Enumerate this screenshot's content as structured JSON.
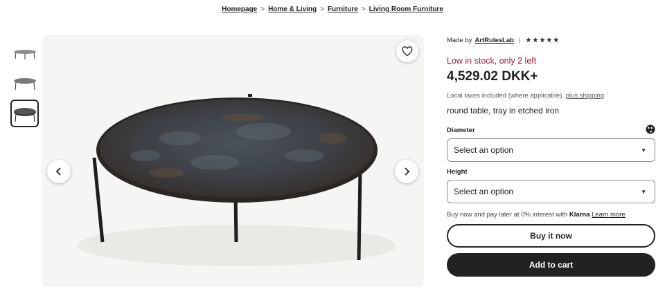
{
  "breadcrumb": {
    "items": [
      "Homepage",
      "Home & Living",
      "Furniture",
      "Living Room Furniture"
    ],
    "separator": ">"
  },
  "gallery": {
    "thumbnails": [
      "table-thumbnail-1",
      "table-thumbnail-2",
      "table-thumbnail-3"
    ],
    "active_index": 2,
    "prev_icon": "chevron-left-icon",
    "next_icon": "chevron-right-icon",
    "favorite_icon": "heart-icon"
  },
  "product": {
    "made_by_label": "Made by",
    "seller": "ArtRulesLab",
    "separator": "|",
    "rating_stars": "★★★★★",
    "rating": 5,
    "stock_notice": "Low in stock, only 2 left",
    "price": "4,529.02 DKK+",
    "tax_note": "Local taxes included (where applicable),",
    "shipping_link": "plus shipping",
    "title": "round table, tray in etched iron"
  },
  "options": {
    "diameter": {
      "label": "Diameter",
      "value": "Select an option"
    },
    "height": {
      "label": "Height",
      "value": "Select an option"
    },
    "globe_icon": "globe-icon",
    "caret": "▼"
  },
  "klarna": {
    "text": "Buy now and pay later at 0% interest with",
    "brand": "Klarna",
    "learn_more": "Learn more"
  },
  "actions": {
    "buy_now": "Buy it now",
    "add_to_cart": "Add to cart"
  },
  "colors": {
    "stock": "#a51d3a",
    "primary": "#222222"
  }
}
